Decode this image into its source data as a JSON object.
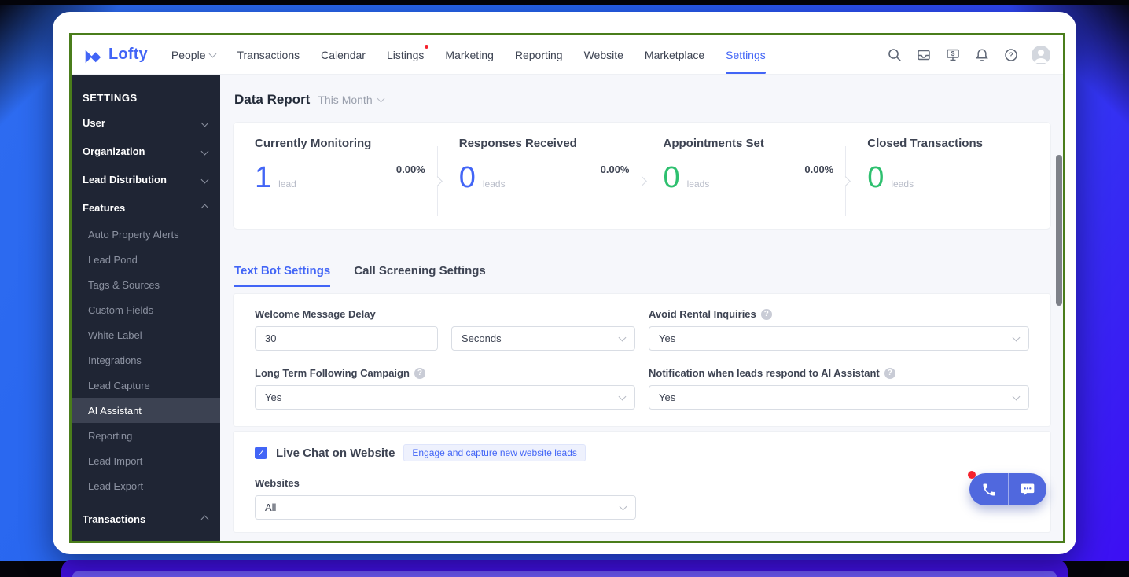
{
  "colors": {
    "accent": "#4265f6",
    "green": "#2ec06f",
    "app_border": "#4a7d1b",
    "fab_bg": "#5068de",
    "badge_bg": "#eef1fd"
  },
  "topnav": {
    "logo": "Lofty",
    "items": [
      {
        "label": "People",
        "has_dropdown": true
      },
      {
        "label": "Transactions"
      },
      {
        "label": "Calendar"
      },
      {
        "label": "Listings",
        "has_notification_dot": true
      },
      {
        "label": "Marketing"
      },
      {
        "label": "Reporting"
      },
      {
        "label": "Website"
      },
      {
        "label": "Marketplace"
      },
      {
        "label": "Settings",
        "active": true
      }
    ],
    "icons": [
      "search",
      "inbox",
      "billing-screen",
      "notifications-bell",
      "help",
      "avatar"
    ]
  },
  "sidebar": {
    "title": "SETTINGS",
    "groups": [
      {
        "label": "User",
        "state": "collapsed"
      },
      {
        "label": "Organization",
        "state": "collapsed"
      },
      {
        "label": "Lead Distribution",
        "state": "collapsed"
      },
      {
        "label": "Features",
        "state": "expanded"
      }
    ],
    "features_items": [
      "Auto Property Alerts",
      "Lead Pond",
      "Tags & Sources",
      "Custom Fields",
      "White Label",
      "Integrations",
      "Lead Capture",
      "AI Assistant",
      "Reporting",
      "Lead Import",
      "Lead Export"
    ],
    "active_item": "AI Assistant",
    "footer_group": {
      "label": "Transactions",
      "state": "expanded"
    }
  },
  "report": {
    "title": "Data Report",
    "period": "This Month",
    "metrics": [
      {
        "label": "Currently Monitoring",
        "value": "1",
        "unit": "lead",
        "color": "#4265f6"
      },
      {
        "label": "Responses Received",
        "value": "0",
        "unit": "leads",
        "color": "#4265f6"
      },
      {
        "label": "Appointments Set",
        "value": "0",
        "unit": "leads",
        "color": "#2ec06f"
      },
      {
        "label": "Closed Transactions",
        "value": "0",
        "unit": "leads",
        "color": "#2ec06f"
      }
    ],
    "rates": [
      "0.00%",
      "0.00%",
      "0.00%"
    ]
  },
  "tabs": {
    "items": [
      "Text Bot Settings",
      "Call Screening Settings"
    ],
    "active": "Text Bot Settings"
  },
  "form": {
    "welcome_delay": {
      "label": "Welcome Message Delay",
      "value": "30",
      "unit_value": "Seconds"
    },
    "avoid_rental": {
      "label": "Avoid Rental Inquiries",
      "value": "Yes",
      "has_help": true
    },
    "long_term": {
      "label": "Long Term Following Campaign",
      "value": "Yes",
      "has_help": true
    },
    "notification": {
      "label": "Notification when leads respond to AI Assistant",
      "value": "Yes",
      "has_help": true
    }
  },
  "live_chat": {
    "checked": true,
    "check_glyph": "✓",
    "label": "Live Chat on Website",
    "badge": "Engage and capture new website leads",
    "websites_label": "Websites",
    "websites_value": "All"
  },
  "fab": {
    "icons": [
      "phone",
      "chat"
    ],
    "has_notification_dot": true
  }
}
